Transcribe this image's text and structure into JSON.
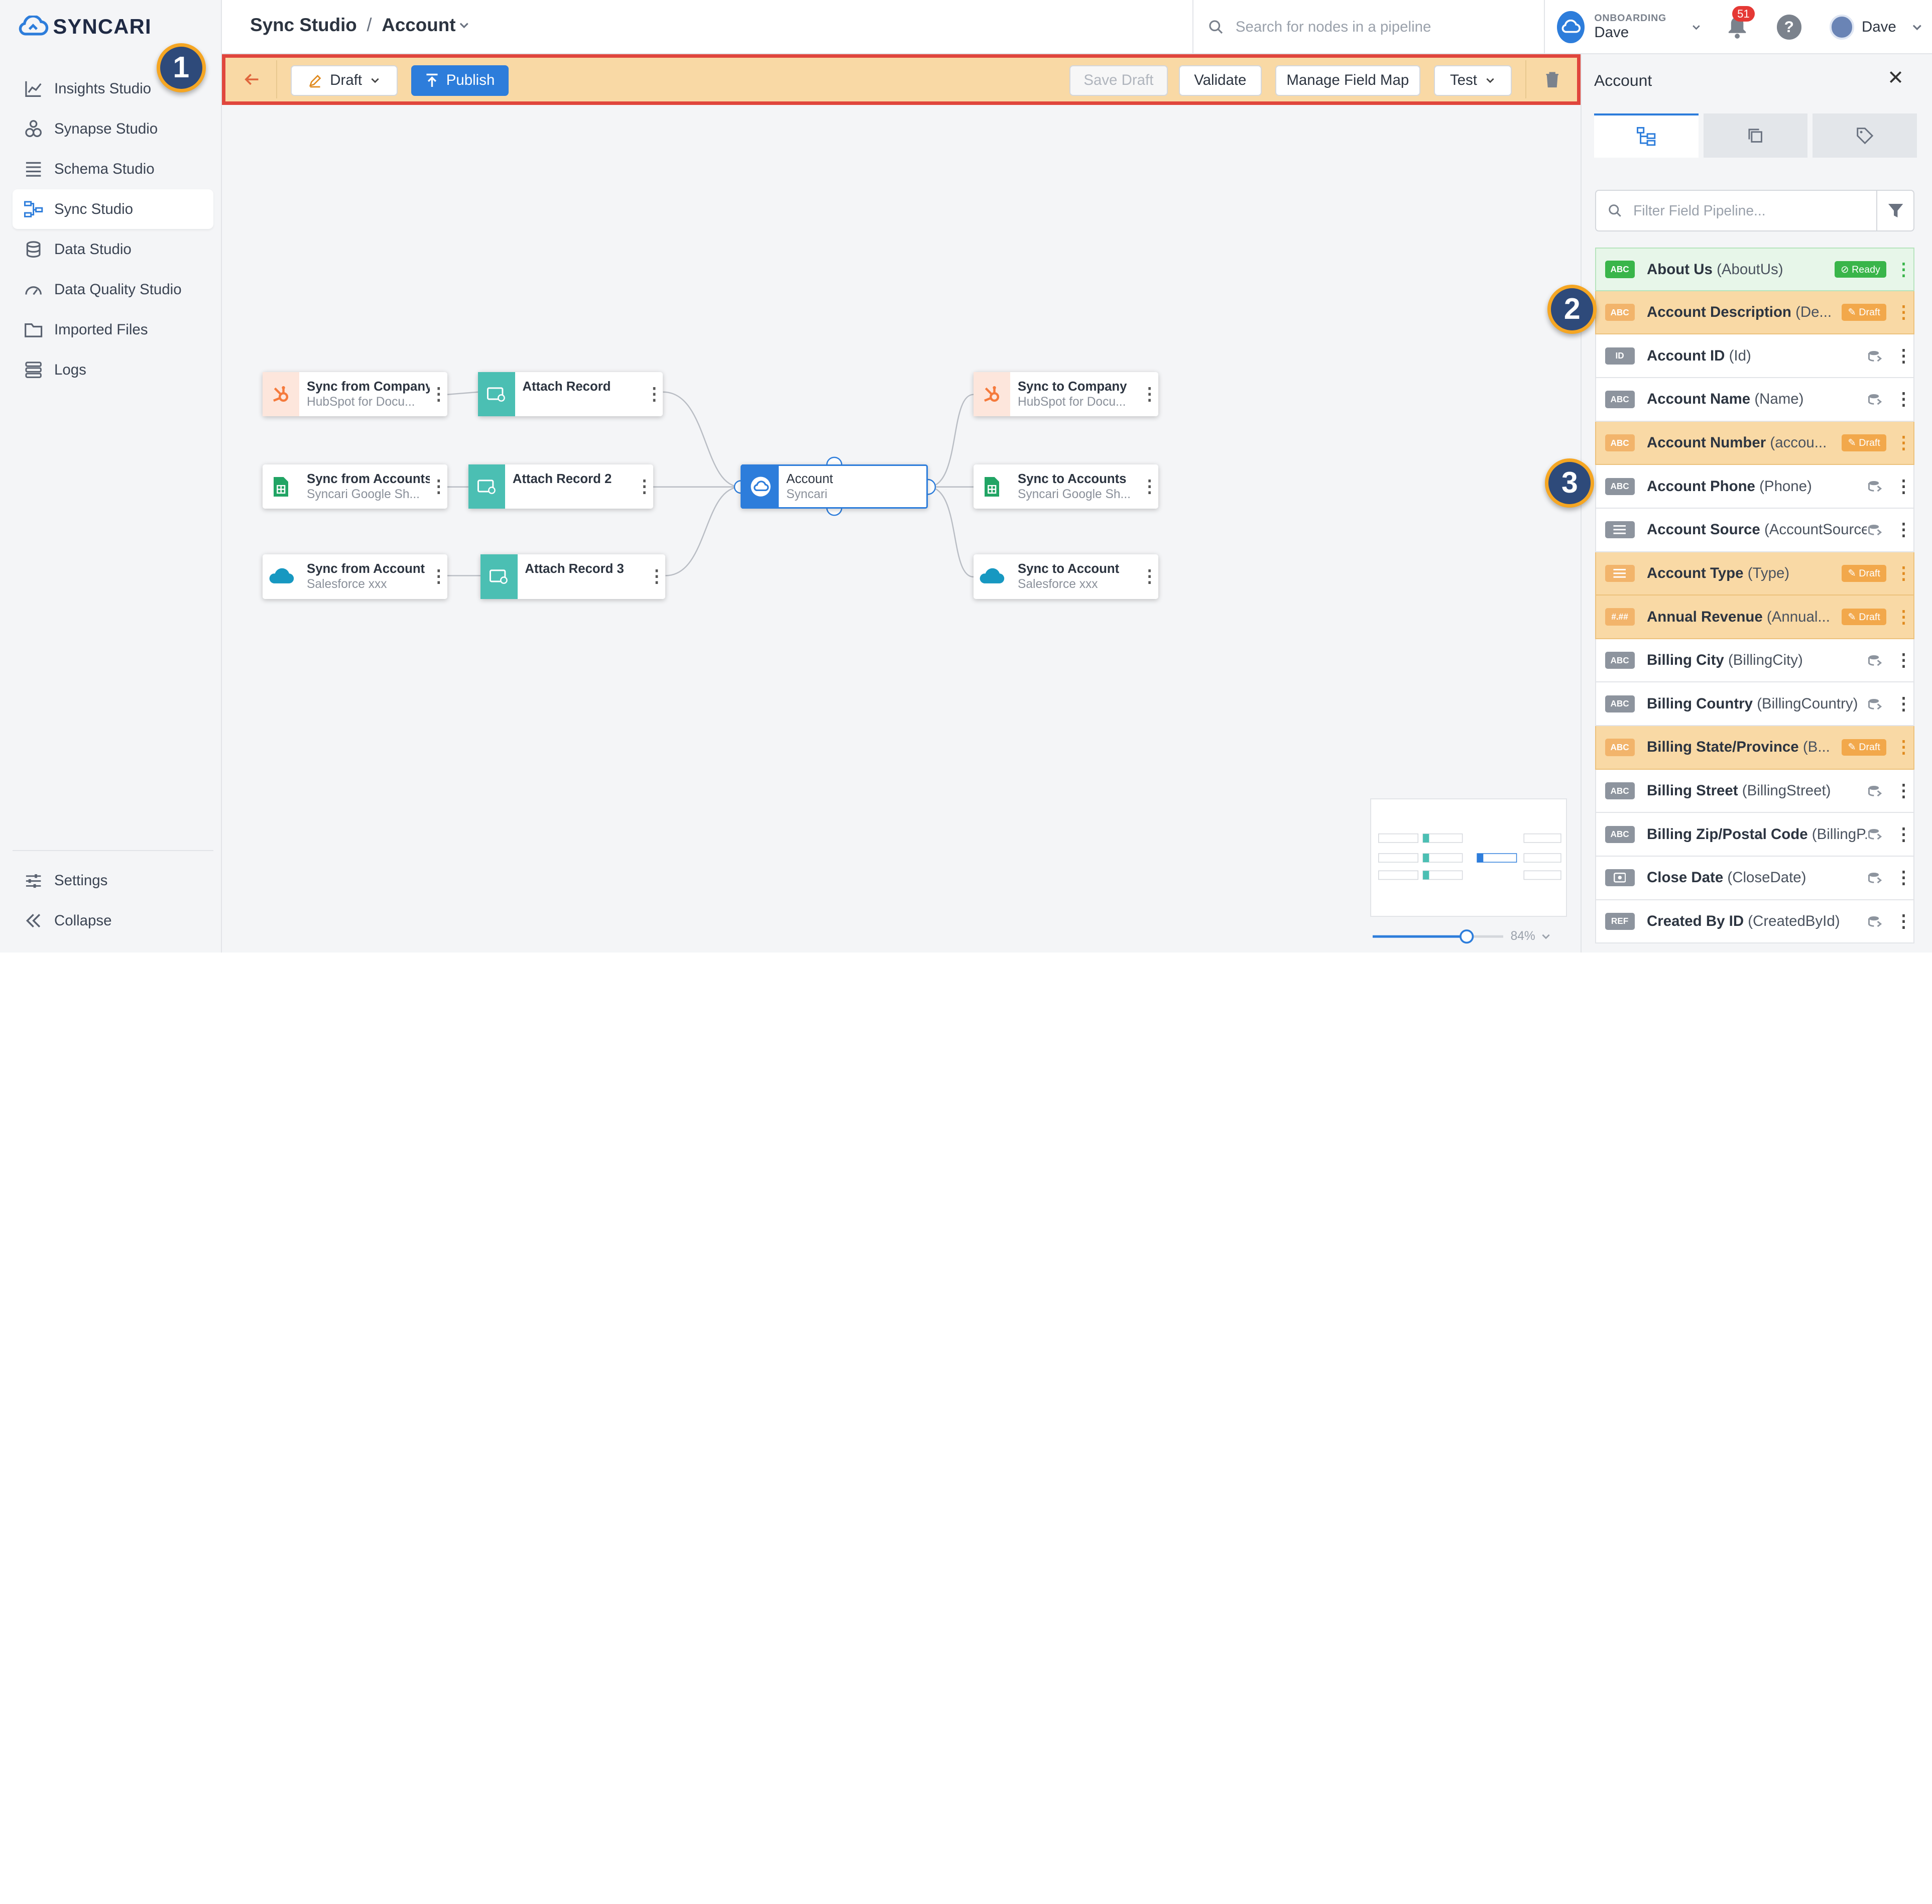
{
  "app": {
    "logo_text": "SYNCARI"
  },
  "sidebar": {
    "items": [
      {
        "label": "Insights Studio"
      },
      {
        "label": "Synapse Studio"
      },
      {
        "label": "Schema Studio"
      },
      {
        "label": "Sync Studio",
        "active": true
      },
      {
        "label": "Data Studio"
      },
      {
        "label": "Data Quality Studio"
      },
      {
        "label": "Imported Files"
      },
      {
        "label": "Logs"
      }
    ],
    "settings_label": "Settings",
    "collapse_label": "Collapse"
  },
  "header": {
    "breadcrumb_root": "Sync Studio",
    "breadcrumb_sep": "/",
    "breadcrumb_current": "Account",
    "search_placeholder": "Search for nodes in a pipeline",
    "org_label": "ONBOARDING",
    "org_name": "Dave",
    "notification_count": "51",
    "user_name": "Dave"
  },
  "toolbar": {
    "draft_label": "Draft",
    "publish_label": "Publish",
    "save_draft_label": "Save Draft",
    "validate_label": "Validate",
    "manage_field_map_label": "Manage Field Map",
    "test_label": "Test"
  },
  "callouts": {
    "one": "1",
    "two": "2",
    "three": "3"
  },
  "pipeline": {
    "sources": [
      {
        "title": "Sync from  Company",
        "subtitle": "HubSpot for Docu...",
        "icon": "hubspot-icon"
      },
      {
        "title": "Sync from  Accounts",
        "subtitle": "Syncari Google Sh...",
        "icon": "google-sheets-icon"
      },
      {
        "title": "Sync from  Account",
        "subtitle": "Salesforce xxx",
        "icon": "salesforce-icon"
      }
    ],
    "attach": [
      {
        "title": "Attach Record"
      },
      {
        "title": "Attach Record 2"
      },
      {
        "title": "Attach Record 3"
      }
    ],
    "entity": {
      "title": "Account",
      "subtitle": "Syncari"
    },
    "destinations": [
      {
        "title": "Sync to  Company",
        "subtitle": "HubSpot for Docu...",
        "icon": "hubspot-icon"
      },
      {
        "title": "Sync to  Accounts",
        "subtitle": "Syncari Google Sh...",
        "icon": "google-sheets-icon"
      },
      {
        "title": "Sync to  Account",
        "subtitle": "Salesforce xxx",
        "icon": "salesforce-icon"
      }
    ]
  },
  "zoom": {
    "level": "84%",
    "slider_fraction": 0.72
  },
  "panel": {
    "title": "Account",
    "filter_placeholder": "Filter Field Pipeline...",
    "fields": [
      {
        "type": "ABC",
        "name": "About Us",
        "api": "(AboutUs)",
        "status": "Ready"
      },
      {
        "type": "ABC",
        "name": "Account Description",
        "api": "(De...",
        "status": "Draft"
      },
      {
        "type": "ID",
        "name": "Account ID",
        "api": "(Id)",
        "status": ""
      },
      {
        "type": "ABC",
        "name": "Account Name",
        "api": "(Name)",
        "status": ""
      },
      {
        "type": "ABC",
        "name": "Account Number",
        "api": "(accou...",
        "status": "Draft"
      },
      {
        "type": "ABC",
        "name": "Account Phone",
        "api": "(Phone)",
        "status": ""
      },
      {
        "type": "LIST",
        "name": "Account Source",
        "api": "(AccountSource)",
        "status": ""
      },
      {
        "type": "LIST",
        "name": "Account Type",
        "api": "(Type)",
        "status": "Draft"
      },
      {
        "type": "#.##",
        "name": "Annual Revenue",
        "api": "(Annual...",
        "status": "Draft"
      },
      {
        "type": "ABC",
        "name": "Billing City",
        "api": "(BillingCity)",
        "status": ""
      },
      {
        "type": "ABC",
        "name": "Billing Country",
        "api": "(BillingCountry)",
        "status": ""
      },
      {
        "type": "ABC",
        "name": "Billing State/Province",
        "api": "(B...",
        "status": "Draft"
      },
      {
        "type": "ABC",
        "name": "Billing Street",
        "api": "(BillingStreet)",
        "status": ""
      },
      {
        "type": "ABC",
        "name": "Billing Zip/Postal Code",
        "api": "(BillingP...",
        "status": ""
      },
      {
        "type": "DATE",
        "name": "Close Date",
        "api": "(CloseDate)",
        "status": ""
      },
      {
        "type": "REF",
        "name": "Created By ID",
        "api": "(CreatedById)",
        "status": ""
      }
    ]
  },
  "colors": {
    "accent": "#2d7ddb",
    "draft": "#f9d9a5",
    "ready": "#39b54a",
    "highlight_border": "#e0463d"
  }
}
